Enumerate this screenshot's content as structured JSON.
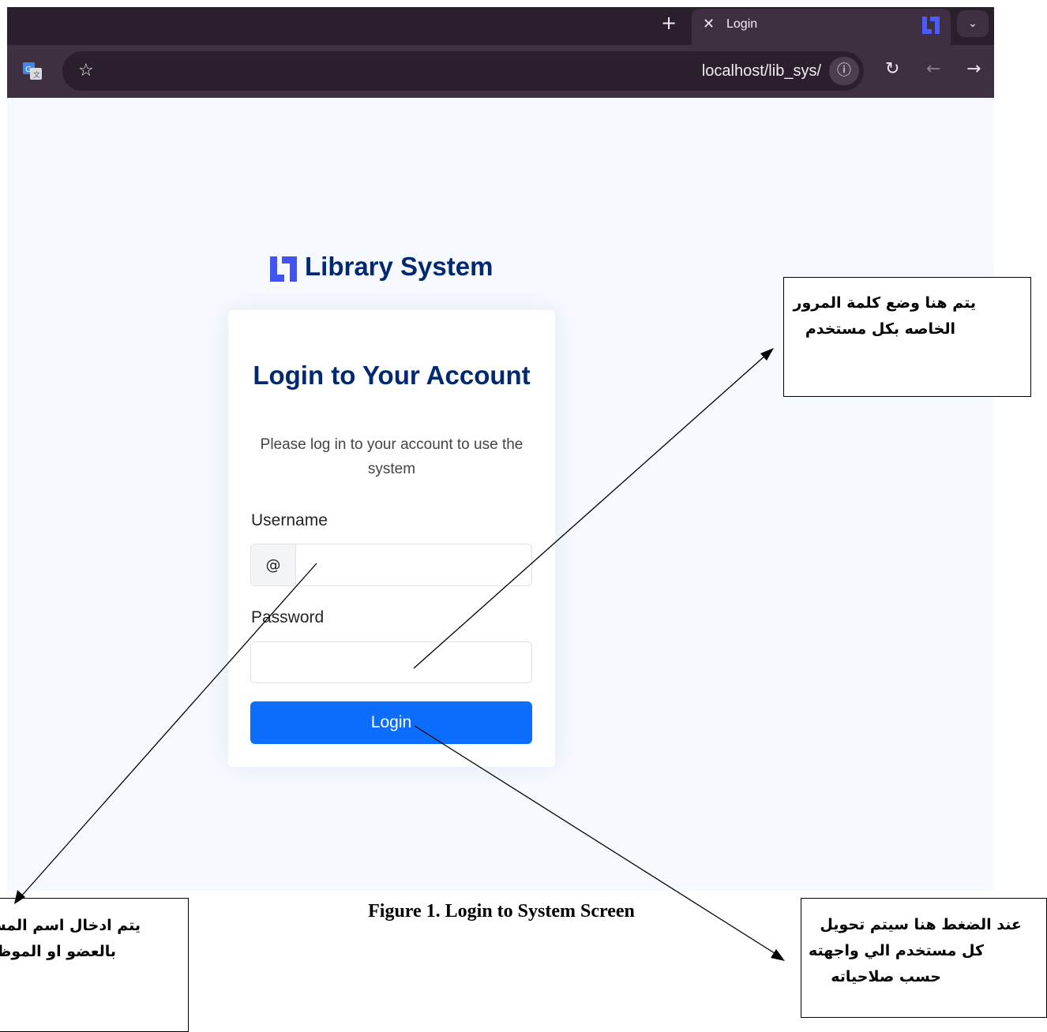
{
  "browser": {
    "tab_title": "Login",
    "new_tab_glyph": "+",
    "close_glyph": "✕",
    "menu_glyph": "⌄",
    "url": "localhost/lib_sys/",
    "star_glyph": "☆",
    "info_glyph": "ⓘ",
    "reload_glyph": "↻",
    "back_glyph": "←",
    "forward_glyph": "→",
    "theme_color": "#3e3040",
    "tab_bar_color": "#2b1f2e",
    "icons": [
      "translate-icon",
      "star-icon",
      "info-icon",
      "reload-icon",
      "back-arrow-icon",
      "forward-arrow-icon",
      "library-favicon-icon"
    ]
  },
  "page": {
    "logo_text": "Library System",
    "brand_color": "#4154f1",
    "title_color": "#012970",
    "title": "Login to Your Account",
    "subtitle": "Please log in to your account to use the system",
    "username_label": "Username",
    "username_prefix": "@",
    "username_value": "",
    "password_label": "Password",
    "password_value": "",
    "login_button": "Login",
    "button_color": "#0d6efd"
  },
  "figure": {
    "caption": "Figure 1. Login to System Screen"
  },
  "annotations": {
    "password_note": [
      "يتم هنا وضع كلمة المرور",
      "الخاصه بكل مستخدم"
    ],
    "username_note": [
      "يتم ادخال اسم المس",
      "بالعضو او الموظ"
    ],
    "login_note": [
      "عند الضغط هنا سيتم تحويل",
      "كل مستخدم الي واجهته",
      "حسب صلاحياته"
    ]
  }
}
